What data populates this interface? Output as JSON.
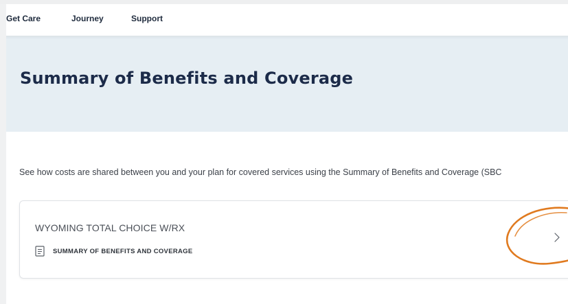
{
  "nav": {
    "items": [
      {
        "label": "Get Care"
      },
      {
        "label": "Journey"
      },
      {
        "label": "Support"
      }
    ]
  },
  "hero": {
    "title": "Summary of Benefits and Coverage"
  },
  "intro_text": "See how costs are shared between you and your plan for covered services using the Summary of Benefits and Coverage (SBC",
  "plan_card": {
    "plan_name": "WYOMING TOTAL CHOICE W/RX",
    "document_link_label": "SUMMARY OF BENEFITS AND COVERAGE",
    "document_icon": "document-icon",
    "chevron_icon": "chevron-right-icon"
  },
  "colors": {
    "hero_background": "#e6eef3",
    "title_color": "#1c2b49",
    "annotation_circle": "#e07a1f"
  }
}
